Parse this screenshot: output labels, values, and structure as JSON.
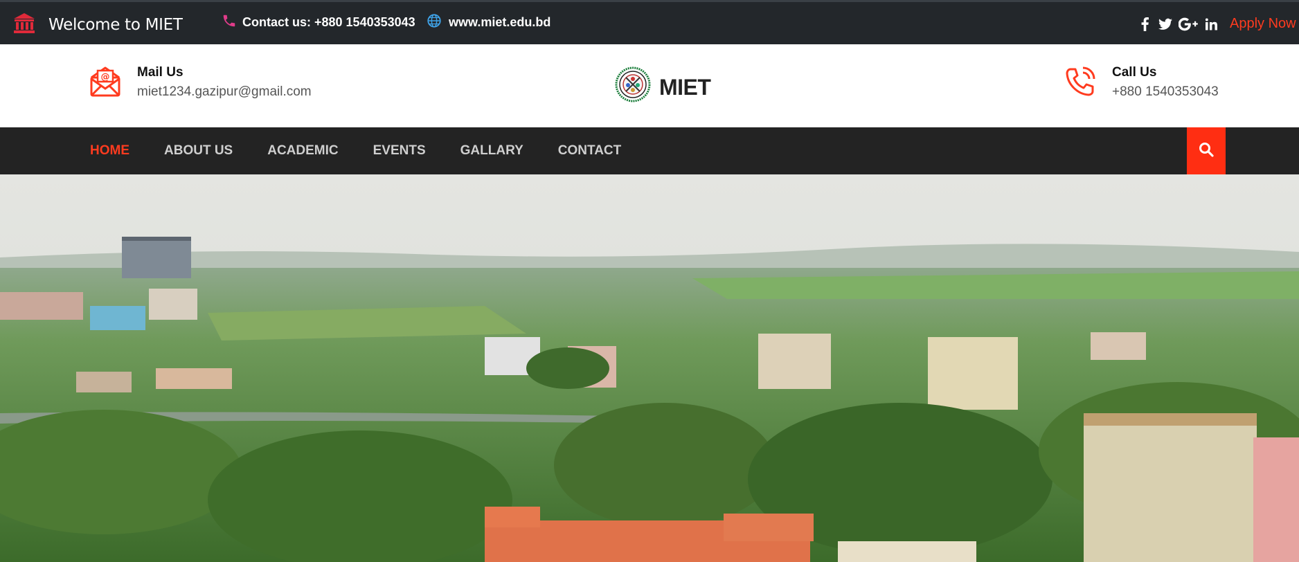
{
  "topbar": {
    "welcome": "Welcome to MIET",
    "contact": "Contact us: +880 1540353043",
    "website": "www.miet.edu.bd",
    "apply": "Apply Now",
    "social_icons": [
      "facebook-icon",
      "twitter-icon",
      "google-plus-icon",
      "linkedin-icon"
    ]
  },
  "header": {
    "mail_label": "Mail Us",
    "mail_value": "miet1234.gazipur@gmail.com",
    "brand": "MIET",
    "call_label": "Call Us",
    "call_value": "+880 1540353043"
  },
  "nav": {
    "items": [
      {
        "label": "HOME"
      },
      {
        "label": "ABOUT US"
      },
      {
        "label": "ACADEMIC"
      },
      {
        "label": "EVENTS"
      },
      {
        "label": "GALLARY"
      },
      {
        "label": "CONTACT"
      }
    ]
  },
  "colors": {
    "accent": "#ff3b1f",
    "topbar_bg": "#23272b",
    "nav_bg": "#232323",
    "icon_red": "#e02a3a"
  }
}
